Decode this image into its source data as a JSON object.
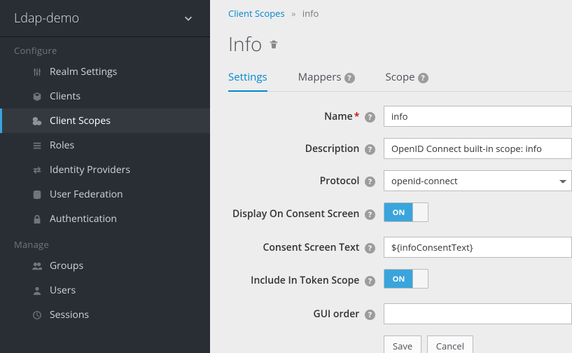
{
  "realm_selector": {
    "name": "Ldap-demo"
  },
  "sidebar": {
    "sections": [
      {
        "title": "Configure",
        "items": [
          {
            "id": "realm-settings",
            "label": "Realm Settings",
            "icon": "sliders"
          },
          {
            "id": "clients",
            "label": "Clients",
            "icon": "cube"
          },
          {
            "id": "client-scopes",
            "label": "Client Scopes",
            "icon": "cubes",
            "active": true
          },
          {
            "id": "roles",
            "label": "Roles",
            "icon": "list"
          },
          {
            "id": "identity-providers",
            "label": "Identity Providers",
            "icon": "exchange"
          },
          {
            "id": "user-federation",
            "label": "User Federation",
            "icon": "database"
          },
          {
            "id": "authentication",
            "label": "Authentication",
            "icon": "lock"
          }
        ]
      },
      {
        "title": "Manage",
        "items": [
          {
            "id": "groups",
            "label": "Groups",
            "icon": "users"
          },
          {
            "id": "users",
            "label": "Users",
            "icon": "user"
          },
          {
            "id": "sessions",
            "label": "Sessions",
            "icon": "clock"
          }
        ]
      }
    ]
  },
  "breadcrumb": {
    "parent": "Client Scopes",
    "current": "info"
  },
  "page": {
    "title": "Info"
  },
  "tabs": [
    {
      "id": "settings",
      "label": "Settings",
      "help": false,
      "active": true
    },
    {
      "id": "mappers",
      "label": "Mappers",
      "help": true
    },
    {
      "id": "scope",
      "label": "Scope",
      "help": true
    }
  ],
  "form": {
    "name": {
      "label": "Name",
      "required": true,
      "value": "info"
    },
    "description": {
      "label": "Description",
      "value": "OpenID Connect built-in scope: info"
    },
    "protocol": {
      "label": "Protocol",
      "value": "openid-connect"
    },
    "display_consent": {
      "label": "Display On Consent Screen",
      "on_text": "ON",
      "value": true
    },
    "consent_text": {
      "label": "Consent Screen Text",
      "value": "${infoConsentText}"
    },
    "include_token": {
      "label": "Include In Token Scope",
      "on_text": "ON",
      "value": true
    },
    "gui_order": {
      "label": "GUI order",
      "value": ""
    }
  },
  "buttons": {
    "save": "Save",
    "cancel": "Cancel"
  }
}
